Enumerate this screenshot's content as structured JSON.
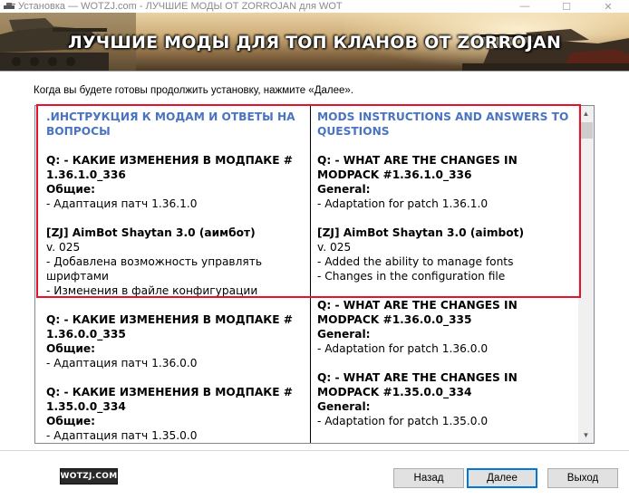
{
  "window": {
    "title": "Установка — WOTZJ.com - ЛУЧШИЕ МОДЫ ОТ ZORROJAN для WOT",
    "controls": {
      "minimize": "—",
      "maximize": "☐",
      "close": "✕"
    }
  },
  "banner": {
    "title": "ЛУЧШИЕ МОДЫ ДЛЯ ТОП КЛАНОВ ОТ ZORROJAN"
  },
  "prompt": "Когда вы будете готовы продолжить установку, нажмите «Далее».",
  "memo": {
    "left": {
      "heading": ".ИНСТРУКЦИЯ К МОДАМ И ОТВЕТЫ НА ВОПРОСЫ",
      "entries": [
        {
          "q": "Q: - КАКИЕ ИЗМЕНЕНИЯ В МОДПАКЕ # 1.36.1.0_336",
          "group": "Общие:",
          "item": "- Адаптация патч 1.36.1.0"
        },
        {
          "mod_title": "[ZJ] AimBot Shaytan 3.0 (аимбот)",
          "version": "v. 025",
          "items": [
            "- Добавлена возможность управлять шрифтами",
            "- Изменения в файле конфигурации"
          ]
        },
        {
          "q": "Q: - КАКИЕ ИЗМЕНЕНИЯ В МОДПАКЕ # 1.36.0.0_335",
          "group": "Общие:",
          "item": "- Адаптация патч 1.36.0.0"
        },
        {
          "q": "Q: - КАКИЕ ИЗМЕНЕНИЯ В МОДПАКЕ # 1.35.0.0_334",
          "group": "Общие:",
          "item": "- Адаптация патч 1.35.0.0"
        }
      ]
    },
    "right": {
      "heading": "MODS INSTRUCTIONS AND ANSWERS TO QUESTIONS",
      "entries": [
        {
          "q": "Q: - WHAT ARE THE CHANGES IN MODPACK #1.36.1.0_336",
          "group": "General:",
          "item": "- Adaptation for patch 1.36.1.0"
        },
        {
          "mod_title": "[ZJ] AimBot Shaytan 3.0 (aimbot)",
          "version": "v. 025",
          "items": [
            "- Added the ability to manage fonts",
            "- Changes in the configuration file"
          ]
        },
        {
          "q": "Q: - WHAT ARE THE CHANGES IN MODPACK #1.36.0.0_335",
          "group": "General:",
          "item": "- Adaptation for patch 1.36.0.0"
        },
        {
          "q": "Q: - WHAT ARE THE CHANGES IN MODPACK #1.35.0.0_334",
          "group": "General:",
          "item": "- Adaptation for patch 1.35.0.0"
        }
      ]
    }
  },
  "footer": {
    "logo": "WOTZJ.COM",
    "back": "Назад",
    "next": "Далее",
    "exit": "Выход"
  },
  "colors": {
    "heading": "#4a74c1",
    "highlight": "#e8102a",
    "primary_border": "#0078d7"
  }
}
